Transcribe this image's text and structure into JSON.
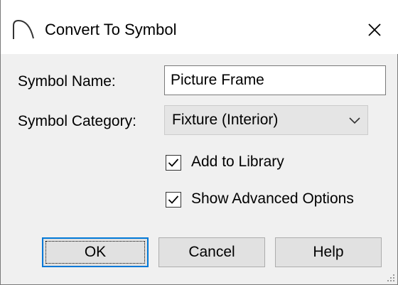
{
  "window": {
    "title": "Convert To Symbol",
    "icon": "arch-icon",
    "close_icon": "close-icon"
  },
  "form": {
    "symbol_name_label": "Symbol Name:",
    "symbol_name_value": "Picture Frame",
    "symbol_category_label": "Symbol Category:",
    "symbol_category_value": "Fixture (Interior)"
  },
  "options": {
    "add_to_library": {
      "label": "Add to Library",
      "checked": true
    },
    "show_advanced": {
      "label": "Show Advanced Options",
      "checked": true
    }
  },
  "buttons": {
    "ok": "OK",
    "cancel": "Cancel",
    "help": "Help"
  },
  "colors": {
    "accent": "#0078d7",
    "background": "#f0f0f0",
    "titlebar": "#ffffff"
  }
}
